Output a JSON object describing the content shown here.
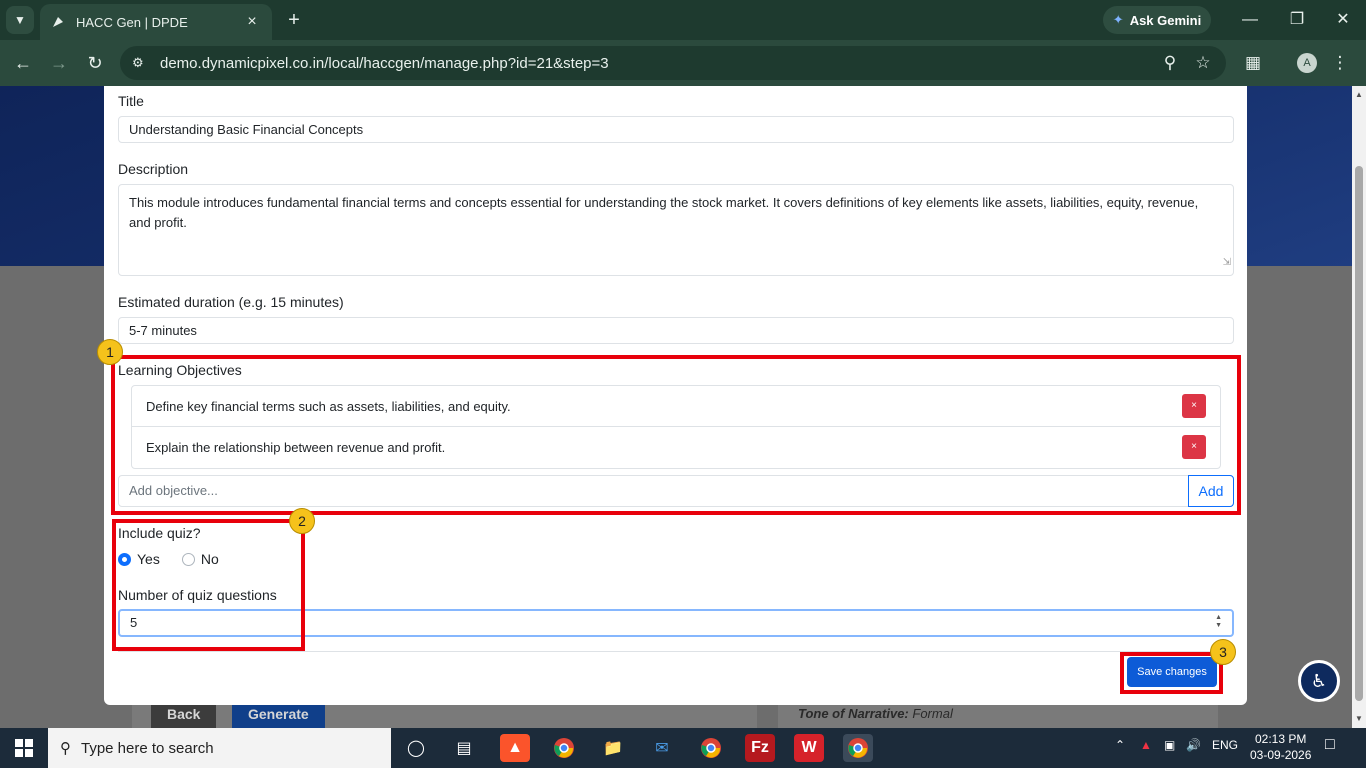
{
  "browser": {
    "tab_title": "HACC Gen | DPDE",
    "tab_close": "×",
    "new_tab": "+",
    "ask_gemini": "Ask Gemini",
    "url": "demo.dynamicpixel.co.in/local/haccgen/manage.php?id=21&step=3",
    "profile_initial": "A"
  },
  "form": {
    "title_label": "Title",
    "title_value": "Understanding Basic Financial Concepts",
    "description_label": "Description",
    "description_value": "This module introduces fundamental financial terms and concepts essential for understanding the stock market. It covers definitions of key elements like assets, liabilities, equity, revenue, and profit.",
    "duration_label": "Estimated duration (e.g. 15 minutes)",
    "duration_value": "5-7 minutes",
    "objectives_label": "Learning Objectives",
    "objectives": [
      {
        "text": "Define key financial terms such as assets, liabilities, and equity.",
        "delete": "×"
      },
      {
        "text": "Explain the relationship between revenue and profit.",
        "delete": "×"
      }
    ],
    "add_objective_placeholder": "Add objective...",
    "add_button": "Add",
    "include_quiz_label": "Include quiz?",
    "quiz_yes": "Yes",
    "quiz_no": "No",
    "quiz_selected": "Yes",
    "num_questions_label": "Number of quiz questions",
    "num_questions_value": "5",
    "save_button": "Save changes"
  },
  "background": {
    "back_button": "Back",
    "generate_button": "Generate",
    "tone_label": "Tone of Narrative:",
    "tone_value": "Formal"
  },
  "annotations": {
    "badge_1": "1",
    "badge_2": "2",
    "badge_3": "3",
    "highlight_color": "#e8000b",
    "badge_color": "#f5c21b"
  },
  "taskbar": {
    "search_placeholder": "Type here to search",
    "language": "ENG",
    "time": "02:13 PM",
    "date": "03-09-2026"
  }
}
